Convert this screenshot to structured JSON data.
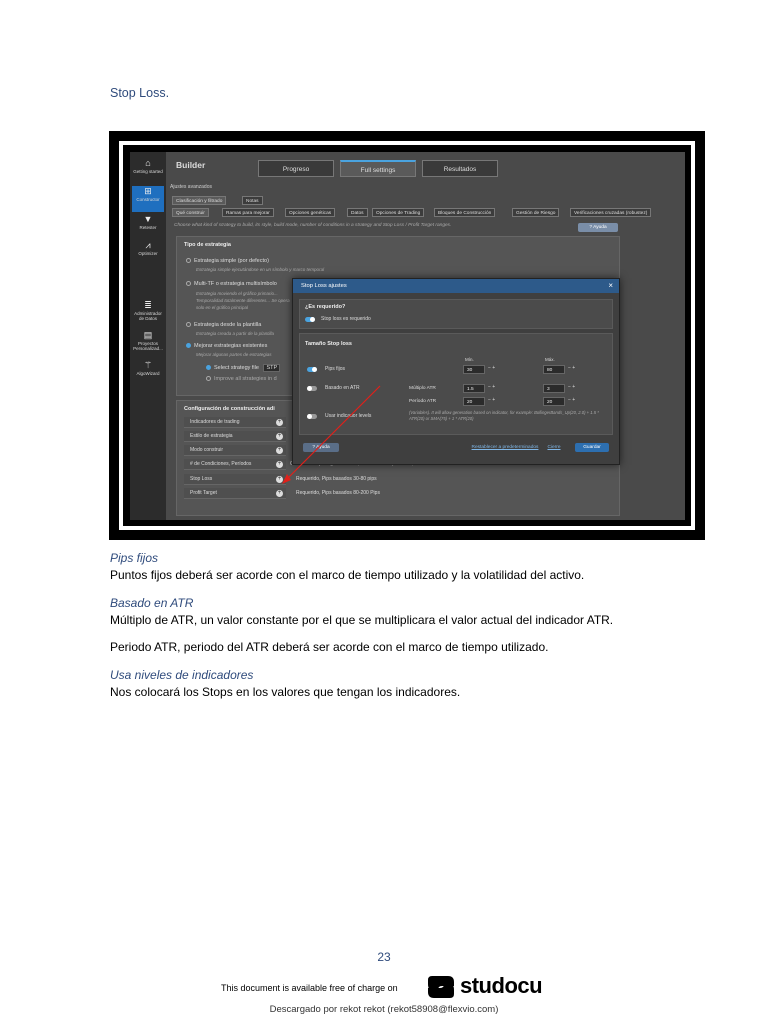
{
  "heading": "Stop Loss.",
  "screenshot": {
    "sidebar": [
      {
        "label": "Getting started",
        "icon": "home-icon"
      },
      {
        "label": "Constructor",
        "icon": "plus-icon",
        "active": true
      },
      {
        "label": "Retester",
        "icon": "filter-icon"
      },
      {
        "label": "Optimizer",
        "icon": "chart-icon"
      },
      {
        "label": "Administrador de Datos",
        "icon": "database-icon"
      },
      {
        "label": "Proyectos Personalizad...",
        "icon": "stack-icon"
      },
      {
        "label": "AlgoWizard",
        "icon": "wand-icon"
      }
    ],
    "title": "Builder",
    "top_tabs": [
      "Progreso",
      "Full settings",
      "Resultados"
    ],
    "breadcrumb": "Ajustes avanzados",
    "sub_tabs": [
      "Clasificación y filtrado",
      "Notas"
    ],
    "section_tabs": [
      "Qué construir",
      "Ramas para mejorar",
      "Opciones genéticas",
      "Datos",
      "Opciones de Trading",
      "Bloques de Construcción",
      "Gestión de Riesgo",
      "Verificaciones cruzadas (robustez)"
    ],
    "description": "Choose what kind of strategy to build, its style, build mode, number of conditions in a strategy and Stop Loss / Profit Target ranges.",
    "help_button": "Ayuda",
    "strategy_type_title": "Tipo de estrategia",
    "strategy_options": [
      {
        "label": "Estrategia simple (por defecto)",
        "sub": "Estrategia simple ejecutándose en un símbolo y marco temporal"
      },
      {
        "label": "Multi-TF o estrategia multisímbolo",
        "sub": "Estrategia moviendo el gráfico primario... Temporalidad totalmente diferentes... Se opera solo en el gráfico principal"
      },
      {
        "label": "Estrategia desde la plantilla",
        "sub": "Estrategia creada a partir de la plantilla"
      },
      {
        "label": "Mejorar estrategias existentes",
        "sub": "Mejorar algunas partes de estrategias"
      }
    ],
    "select_strategy_label": "Select strategy file",
    "select_strategy_value": "STP",
    "improve_all_label": "Improve all strategies in d",
    "config_title": "Configuración de construcción adi",
    "config_rows": [
      {
        "label": "Indicadores de trading",
        "value": ""
      },
      {
        "label": "Estilo de estrategia",
        "value": ""
      },
      {
        "label": "Modo construir",
        "value": ""
      },
      {
        "label": "# de Condiciones, Períodos",
        "value": "Condiciones para generar: 1-3, Max lookback period: 3, Períodos de indicadores: 5-200"
      },
      {
        "label": "Stop Loss",
        "value": "Requerido, Pips basados 30-80 pips"
      },
      {
        "label": "Profit Target",
        "value": "Requerido, Pips basados 80-200 Pips"
      }
    ],
    "dialog": {
      "title": "Stop Loss ajustes",
      "close": "×",
      "required_title": "¿Es requerido?",
      "required_label": "Stop loss es requerido",
      "size_title": "Tamaño Stop loss",
      "min_label": "Mín.",
      "max_label": "Máx.",
      "pips_label": "Pips fijos",
      "pips_min": "30",
      "pips_max": "80",
      "atr_label": "Basado en ATR",
      "atr_mult_label": "Múltiplo ATR",
      "atr_mult_min": "1.5",
      "atr_mult_max": "3",
      "atr_period_label": "Período ATR",
      "atr_period_min": "20",
      "atr_period_max": "20",
      "indicator_label": "Usar indicador levels",
      "indicator_note": "(Variables). It will allow generation based on indicator, for example: BollingerBands_Up(20, 2.0) + 1.5 * ATR(20) or SMA(75) + 1 * ATR(20)",
      "help_button": "Ayuda",
      "reset_link": "Restablecer a predeterminados",
      "cancel_link": "Cierre",
      "save_button": "Guardar"
    },
    "colors": {
      "accent": "#4aa3df",
      "dialog_header": "#2d5a8a",
      "arrow": "#e0201a"
    }
  },
  "sections": [
    {
      "title": "Pips fijos",
      "paragraphs": [
        "Puntos fijos deberá ser acorde con el marco de tiempo utilizado y la volatilidad del activo."
      ]
    },
    {
      "title": "Basado en ATR",
      "paragraphs": [
        "Múltiplo de ATR, un valor constante por el que se multiplicara el valor actual del indicador ATR.",
        "Periodo ATR, periodo del ATR deberá ser acorde con el marco de tiempo utilizado."
      ]
    },
    {
      "title": "Usa niveles de indicadores",
      "paragraphs": [
        "Nos colocará los Stops en los valores que tengan los indicadores."
      ]
    }
  ],
  "page_number": "23",
  "footer_note": "This document is available free of charge on",
  "logo_text": "studocu",
  "download_note": "Descargado por rekot rekot (rekot58908@flexvio.com)"
}
